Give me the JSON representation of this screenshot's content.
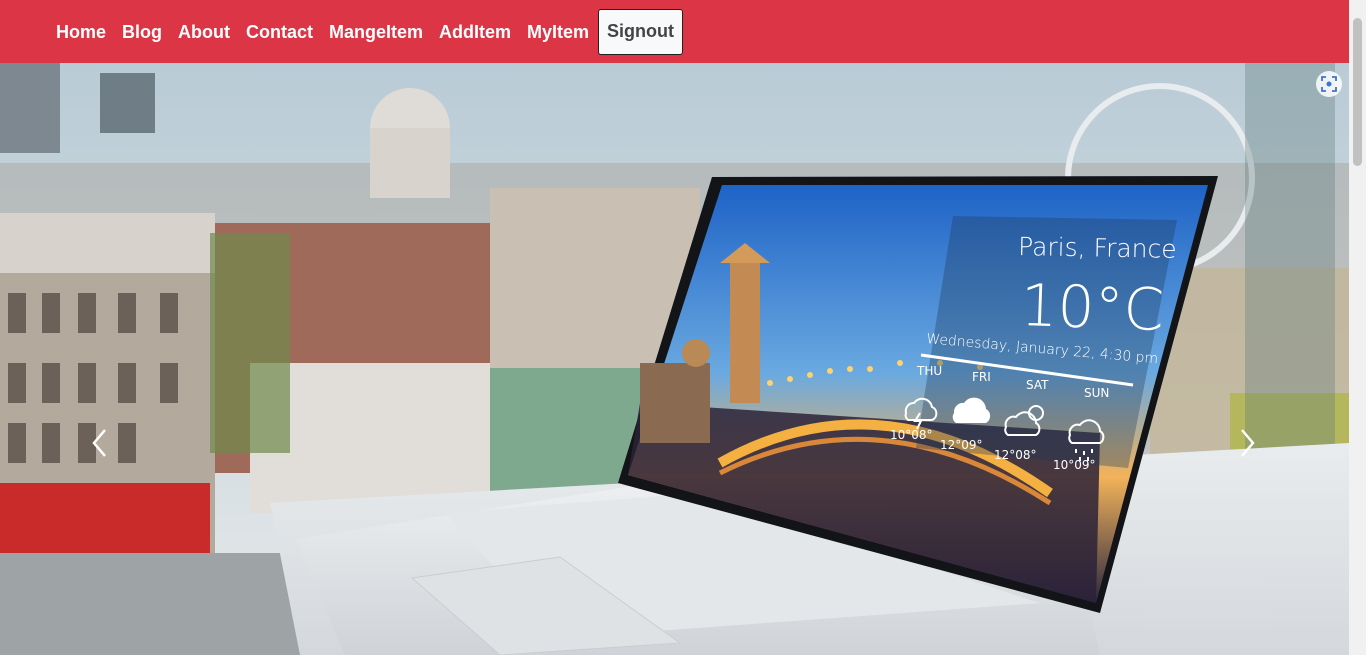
{
  "nav": {
    "items": [
      {
        "label": "Home",
        "name": "nav-home"
      },
      {
        "label": "Blog",
        "name": "nav-blog"
      },
      {
        "label": "About",
        "name": "nav-about"
      },
      {
        "label": "Contact",
        "name": "nav-contact"
      },
      {
        "label": "MangeItem",
        "name": "nav-mangeitem"
      },
      {
        "label": "AddItem",
        "name": "nav-additem"
      },
      {
        "label": "MyItem",
        "name": "nav-myitem"
      }
    ],
    "signout_label": "Signout",
    "bg_color": "#dc3545"
  },
  "hero": {
    "weather_widget": {
      "city": "Paris, France",
      "temperature": "10°C",
      "datetime": "Wednesday, January 22, 4:30 pm",
      "days": [
        {
          "day": "THU",
          "temps": "10°08°",
          "icon": "thunder-cloud-icon"
        },
        {
          "day": "FRI",
          "temps": "12°09°",
          "icon": "cloud-icon"
        },
        {
          "day": "SAT",
          "temps": "12°08°",
          "icon": "sun-cloud-icon"
        },
        {
          "day": "SUN",
          "temps": "10°09°",
          "icon": "rain-cloud-icon"
        }
      ]
    },
    "prev_icon": "chevron-left-icon",
    "next_icon": "chevron-right-icon",
    "lens_icon": "visual-search-icon"
  }
}
